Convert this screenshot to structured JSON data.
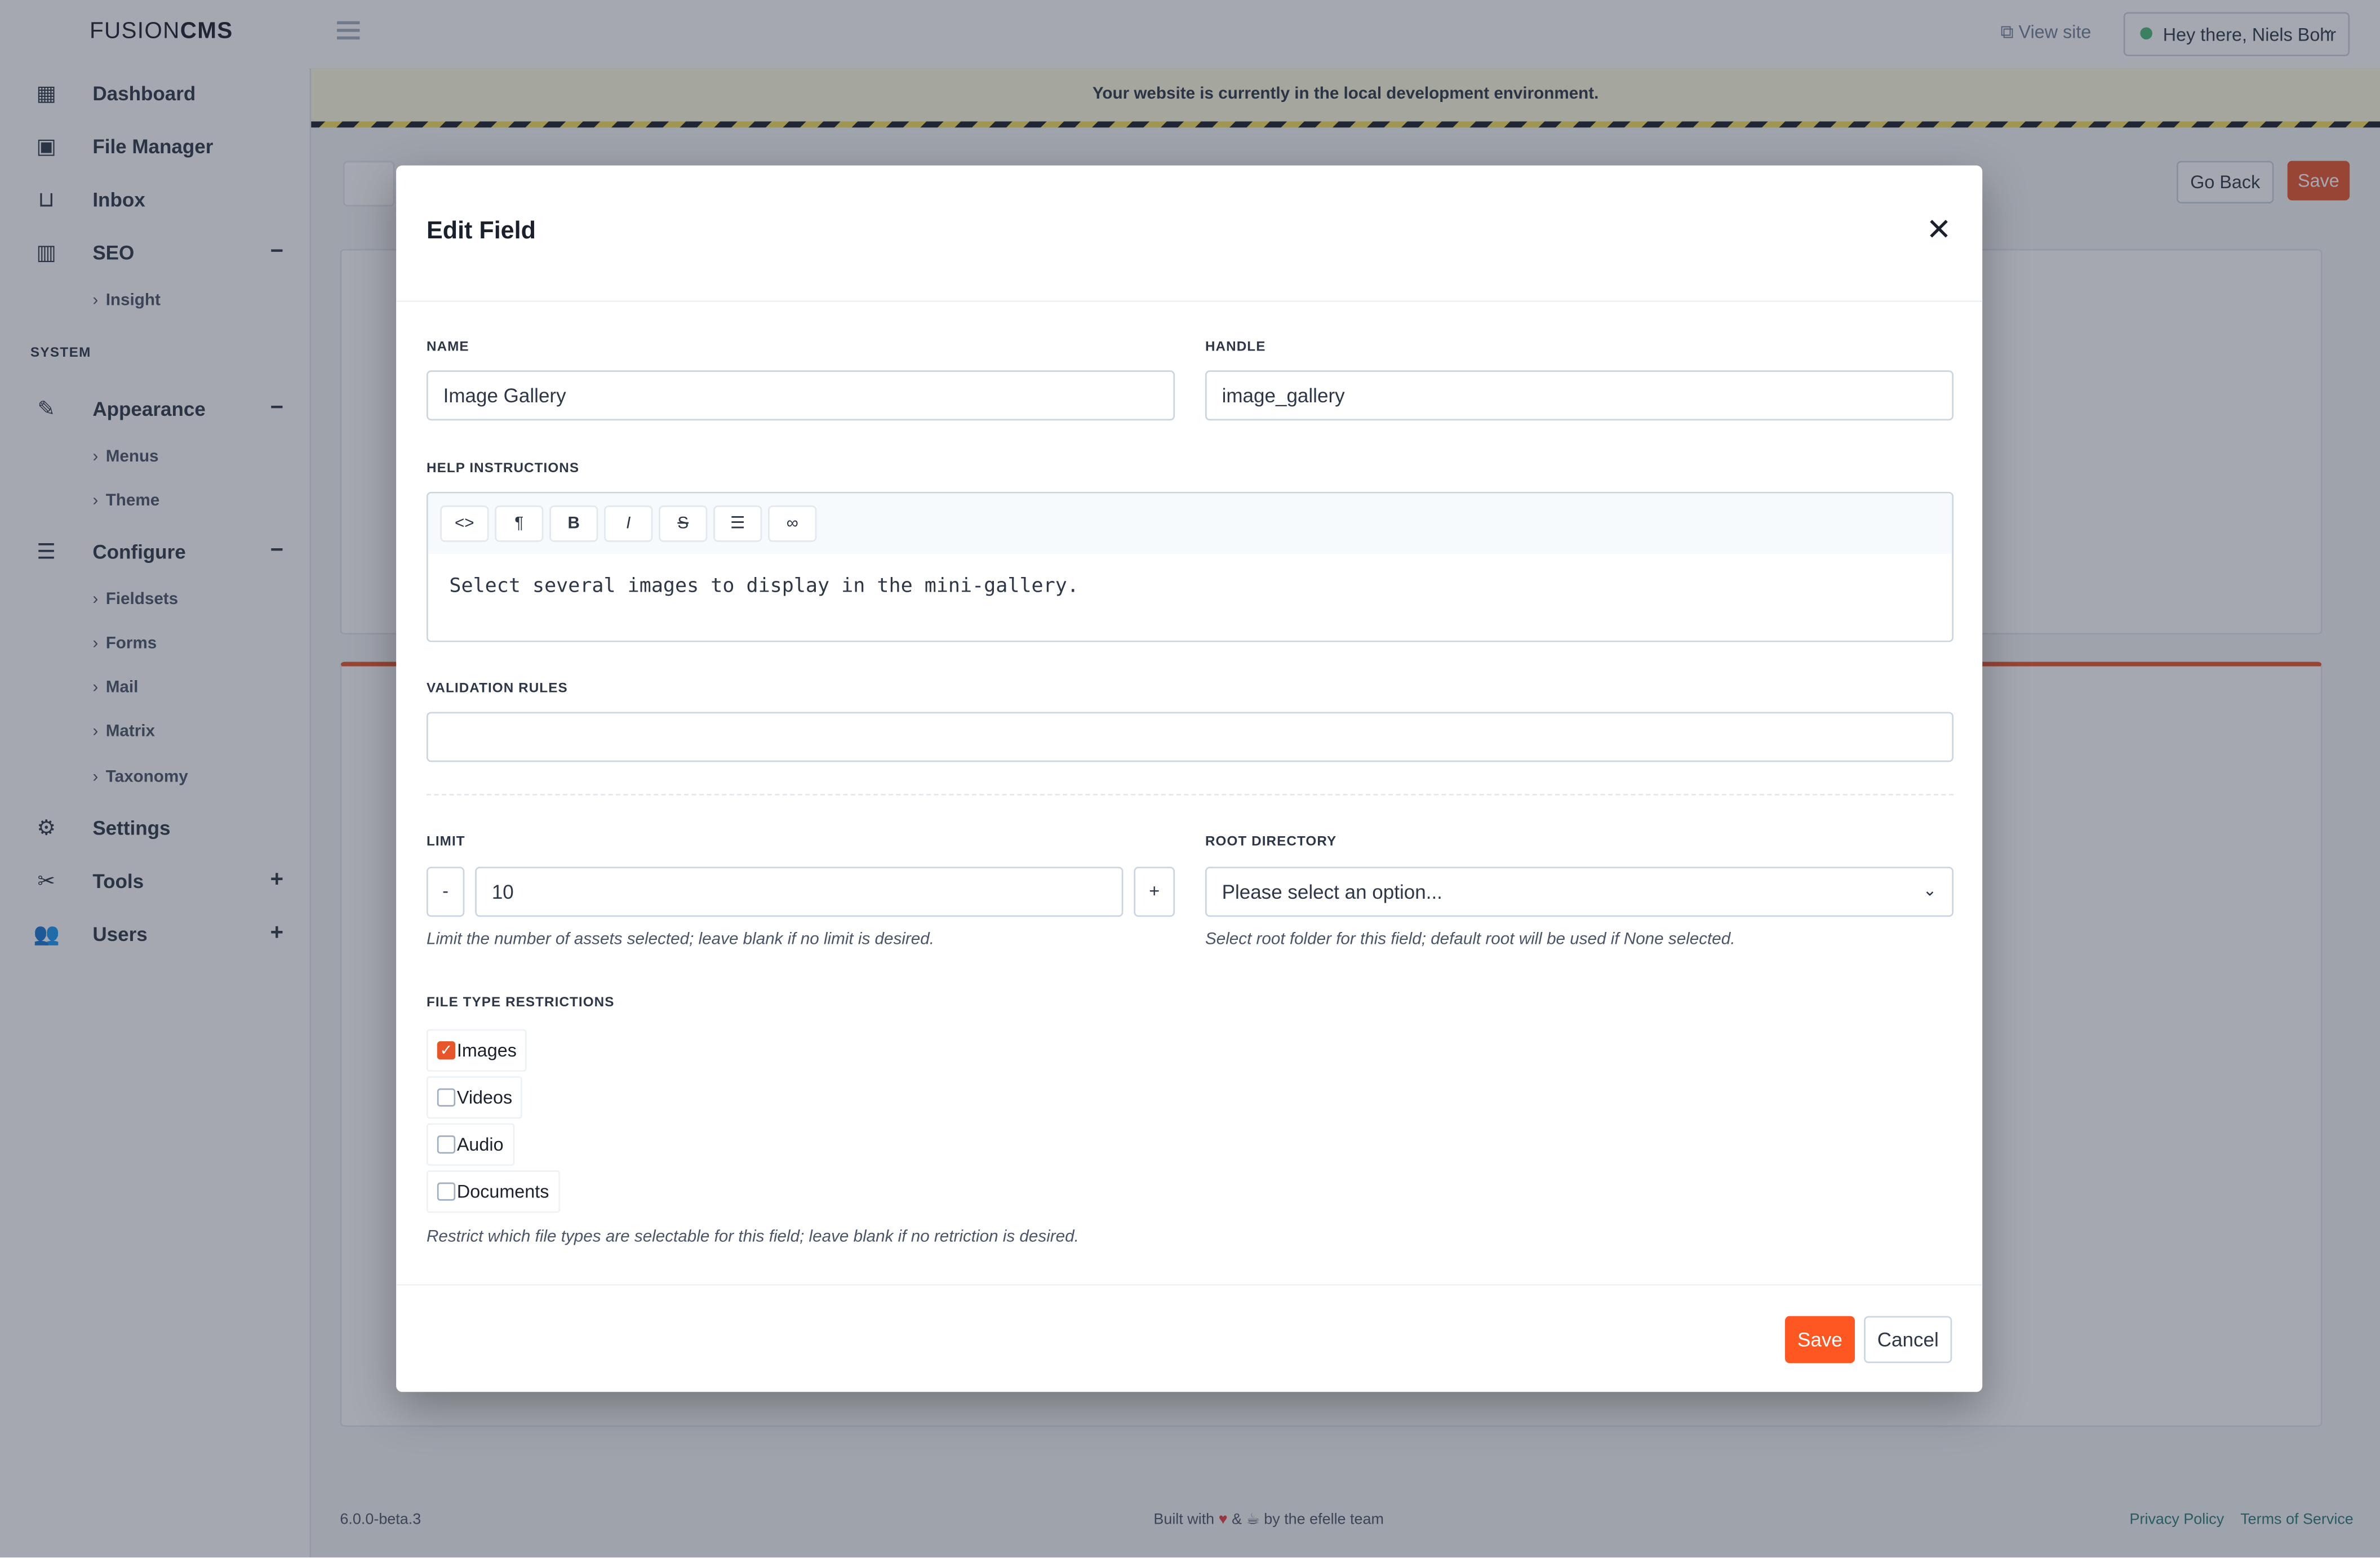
{
  "app": {
    "logo_prefix": "FUSION",
    "logo_bold": "CMS"
  },
  "topbar": {
    "view_site": "View site",
    "user": "Hey there, Niels Bohr"
  },
  "sidebar": {
    "items": [
      {
        "label": "Dashboard",
        "icon": "grid-icon"
      },
      {
        "label": "File Manager",
        "icon": "images-icon"
      },
      {
        "label": "Inbox",
        "icon": "inbox-icon"
      },
      {
        "label": "SEO",
        "icon": "chart-icon",
        "toggle": "−"
      },
      {
        "label": "Appearance",
        "icon": "paint-icon",
        "toggle": "−"
      },
      {
        "label": "Configure",
        "icon": "sliders-icon",
        "toggle": "−"
      },
      {
        "label": "Settings",
        "icon": "gear-icon"
      },
      {
        "label": "Tools",
        "icon": "tools-icon",
        "toggle": "+"
      },
      {
        "label": "Users",
        "icon": "users-icon",
        "toggle": "+"
      }
    ],
    "seo_sub": [
      "Insight"
    ],
    "system_heading": "SYSTEM",
    "appearance_sub": [
      "Menus",
      "Theme"
    ],
    "configure_sub": [
      "Fieldsets",
      "Forms",
      "Mail",
      "Matrix",
      "Taxonomy"
    ]
  },
  "env_banner": "Your website is currently in the local development environment.",
  "page_actions": {
    "go_back": "Go Back",
    "save": "Save"
  },
  "footer": {
    "version": "6.0.0-beta.3",
    "built_pre": "Built with",
    "built_post": "by the efelle team",
    "privacy": "Privacy Policy",
    "terms": "Terms of Service"
  },
  "modal": {
    "title": "Edit Field",
    "name": {
      "label": "NAME",
      "value": "Image Gallery"
    },
    "handle": {
      "label": "HANDLE",
      "value": "image_gallery"
    },
    "help": {
      "label": "HELP INSTRUCTIONS",
      "text": "Select several images to display in the mini-gallery."
    },
    "editor_buttons": [
      "<>",
      "¶",
      "B",
      "I",
      "S",
      "list",
      "link"
    ],
    "validation": {
      "label": "VALIDATION RULES",
      "value": ""
    },
    "limit": {
      "label": "LIMIT",
      "value": "10",
      "minus": "-",
      "plus": "+",
      "help": "Limit the number of assets selected; leave blank if no limit is desired."
    },
    "root_directory": {
      "label": "ROOT DIRECTORY",
      "value": "Please select an option...",
      "help": "Select root folder for this field; default root will be used if None selected."
    },
    "file_types": {
      "label": "FILE TYPE RESTRICTIONS",
      "options": [
        {
          "label": "Images",
          "checked": true
        },
        {
          "label": "Videos",
          "checked": false
        },
        {
          "label": "Audio",
          "checked": false
        },
        {
          "label": "Documents",
          "checked": false
        }
      ],
      "help": "Restrict which file types are selectable for this field; leave blank if no retriction is desired."
    },
    "save": "Save",
    "cancel": "Cancel"
  },
  "colors": {
    "accent": "#ff5722",
    "env_banner": "#fffbe0",
    "link": "#2c7a7b"
  }
}
